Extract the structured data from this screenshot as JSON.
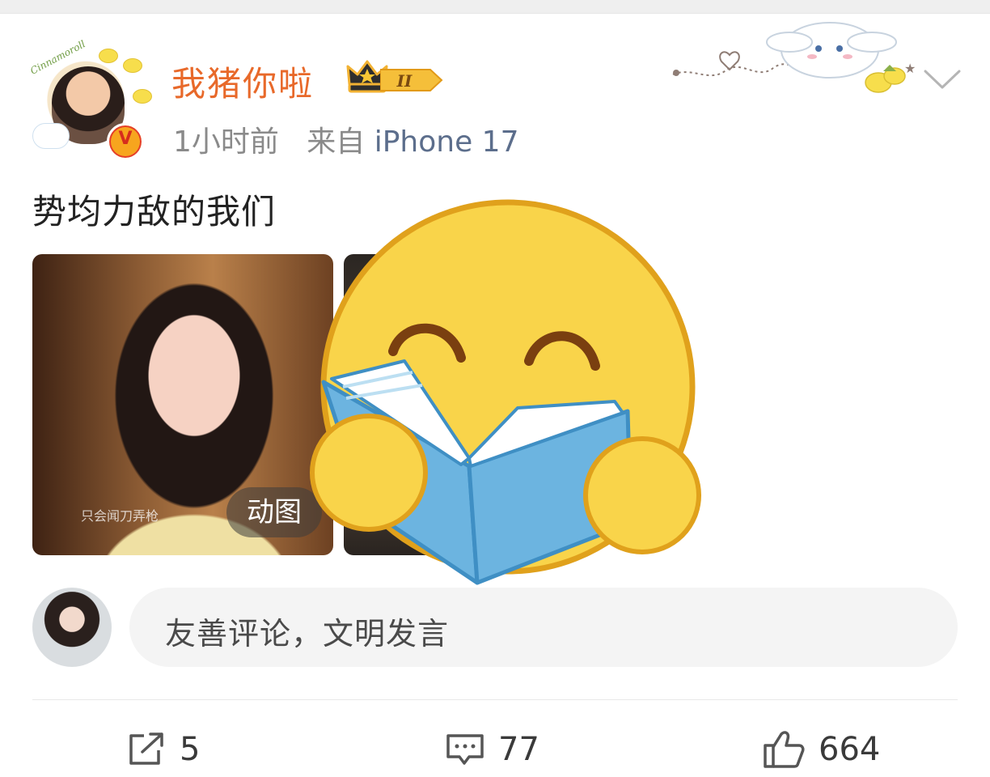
{
  "post": {
    "username": "我猪你啦",
    "level_badge": "II",
    "time": "1小时前",
    "source_prefix": "来自",
    "source": "iPhone 17",
    "text": "势均力敌的我们",
    "avatar_script": "Cinnamoroll",
    "verify_mark": "V"
  },
  "media": {
    "thumb1_caption": "只会闻刀弄枪",
    "gif_label": "动图"
  },
  "comment_box": {
    "placeholder": "友善评论，文明发言"
  },
  "actions": {
    "repost_count": "5",
    "comment_count": "77",
    "like_count": "664"
  },
  "colors": {
    "username": "#e8692a",
    "source": "#5c6e8c",
    "emoji_face": "#f9d44a",
    "emoji_outline": "#e0a11c",
    "book": "#6cb4e0"
  },
  "icons": [
    "crown-icon",
    "level-badge-icon",
    "verify-badge-icon",
    "chevron-down-icon",
    "repost-icon",
    "comment-icon",
    "like-icon",
    "reading-emoji-icon"
  ]
}
